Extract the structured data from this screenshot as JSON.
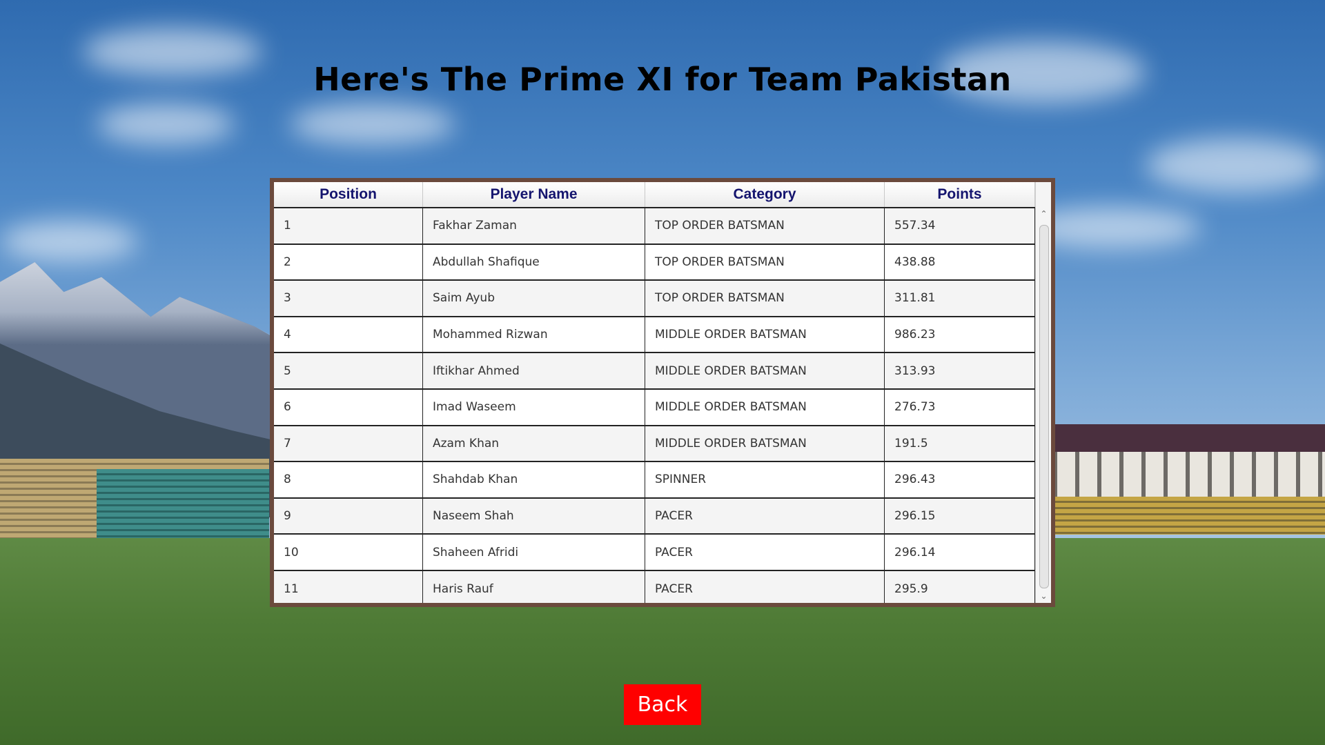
{
  "page": {
    "title": "Here's The Prime XI for Team Pakistan"
  },
  "table": {
    "columns": [
      "Position",
      "Player Name",
      "Category",
      "Points"
    ],
    "rows": [
      [
        "1",
        "Fakhar Zaman",
        "TOP ORDER BATSMAN",
        "557.34"
      ],
      [
        "2",
        "Abdullah Shafique",
        "TOP ORDER BATSMAN",
        "438.88"
      ],
      [
        "3",
        "Saim Ayub",
        "TOP ORDER BATSMAN",
        "311.81"
      ],
      [
        "4",
        "Mohammed Rizwan",
        "MIDDLE ORDER BATSMAN",
        "986.23"
      ],
      [
        "5",
        "Iftikhar Ahmed",
        "MIDDLE ORDER BATSMAN",
        "313.93"
      ],
      [
        "6",
        "Imad Waseem",
        "MIDDLE ORDER BATSMAN",
        "276.73"
      ],
      [
        "7",
        "Azam Khan",
        "MIDDLE ORDER BATSMAN",
        "191.5"
      ],
      [
        "8",
        "Shahdab Khan",
        "SPINNER",
        "296.43"
      ],
      [
        "9",
        "Naseem Shah",
        "PACER",
        "296.15"
      ],
      [
        "10",
        "Shaheen Afridi",
        "PACER",
        "296.14"
      ],
      [
        "11",
        "Haris Rauf",
        "PACER",
        "295.9"
      ]
    ]
  },
  "back_button": {
    "label": "Back"
  },
  "icons": {
    "scroll_up": "chevron-up-icon",
    "scroll_down": "chevron-down-icon"
  },
  "colors": {
    "title": "#000000",
    "header_text": "#14146e",
    "panel_border": "#6b4a3d",
    "back_button": "#ff0000"
  }
}
